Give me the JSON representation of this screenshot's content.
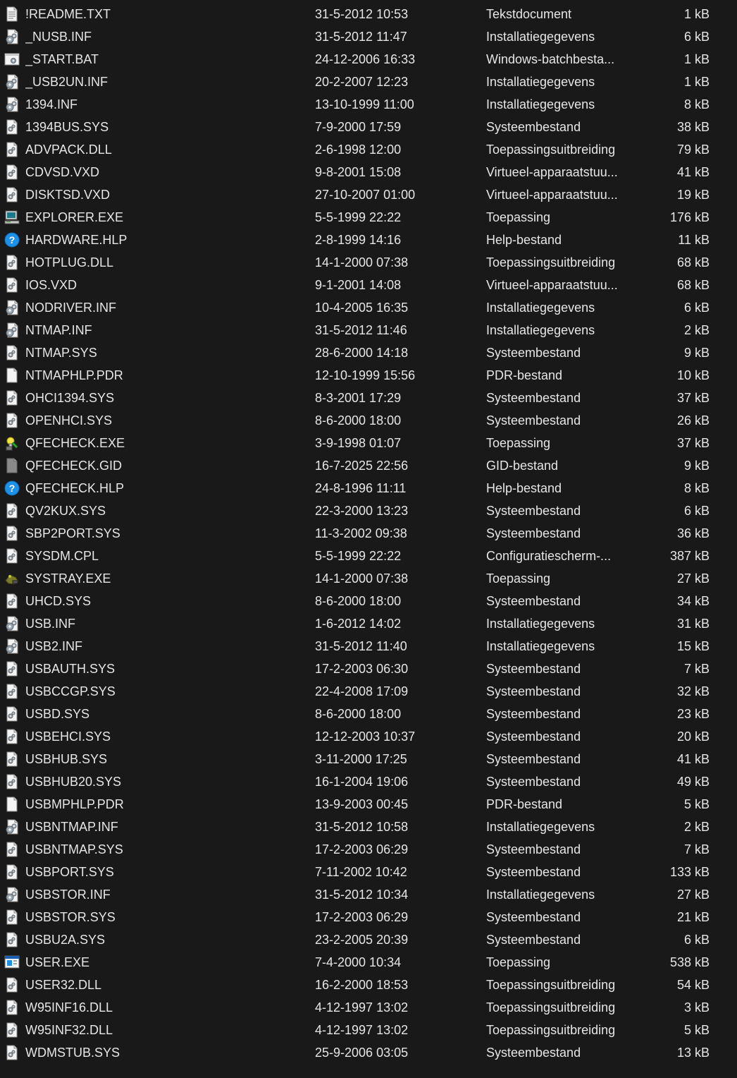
{
  "files": [
    {
      "name": "!README.TXT",
      "date": "31-5-2012 10:53",
      "type": "Tekstdocument",
      "size": "1 kB",
      "icon": "text-document-icon"
    },
    {
      "name": "_NUSB.INF",
      "date": "31-5-2012 11:47",
      "type": "Installatiegegevens",
      "size": "6 kB",
      "icon": "setup-info-icon"
    },
    {
      "name": "_START.BAT",
      "date": "24-12-2006 16:33",
      "type": "Windows-batchbesta...",
      "size": "1 kB",
      "icon": "batch-file-icon"
    },
    {
      "name": "_USB2UN.INF",
      "date": "20-2-2007 12:23",
      "type": "Installatiegegevens",
      "size": "1 kB",
      "icon": "setup-info-icon"
    },
    {
      "name": "1394.INF",
      "date": "13-10-1999 11:00",
      "type": "Installatiegegevens",
      "size": "8 kB",
      "icon": "setup-info-icon"
    },
    {
      "name": "1394BUS.SYS",
      "date": "7-9-2000 17:59",
      "type": "Systeembestand",
      "size": "38 kB",
      "icon": "system-file-icon"
    },
    {
      "name": "ADVPACK.DLL",
      "date": "2-6-1998 12:00",
      "type": "Toepassingsuitbreiding",
      "size": "79 kB",
      "icon": "system-file-icon"
    },
    {
      "name": "CDVSD.VXD",
      "date": "9-8-2001 15:08",
      "type": "Virtueel-apparaatstuu...",
      "size": "41 kB",
      "icon": "system-file-icon"
    },
    {
      "name": "DISKTSD.VXD",
      "date": "27-10-2007 01:00",
      "type": "Virtueel-apparaatstuu...",
      "size": "19 kB",
      "icon": "system-file-icon"
    },
    {
      "name": "EXPLORER.EXE",
      "date": "5-5-1999 22:22",
      "type": "Toepassing",
      "size": "176 kB",
      "icon": "computer-icon"
    },
    {
      "name": "HARDWARE.HLP",
      "date": "2-8-1999 14:16",
      "type": "Help-bestand",
      "size": "11 kB",
      "icon": "help-icon"
    },
    {
      "name": "HOTPLUG.DLL",
      "date": "14-1-2000 07:38",
      "type": "Toepassingsuitbreiding",
      "size": "68 kB",
      "icon": "system-file-icon"
    },
    {
      "name": "IOS.VXD",
      "date": "9-1-2001 14:08",
      "type": "Virtueel-apparaatstuu...",
      "size": "68 kB",
      "icon": "system-file-icon"
    },
    {
      "name": "NODRIVER.INF",
      "date": "10-4-2005 16:35",
      "type": "Installatiegegevens",
      "size": "6 kB",
      "icon": "setup-info-icon"
    },
    {
      "name": "NTMAP.INF",
      "date": "31-5-2012 11:46",
      "type": "Installatiegegevens",
      "size": "2 kB",
      "icon": "setup-info-icon"
    },
    {
      "name": "NTMAP.SYS",
      "date": "28-6-2000 14:18",
      "type": "Systeembestand",
      "size": "9 kB",
      "icon": "system-file-icon"
    },
    {
      "name": "NTMAPHLP.PDR",
      "date": "12-10-1999 15:56",
      "type": "PDR-bestand",
      "size": "10 kB",
      "icon": "blank-file-icon"
    },
    {
      "name": "OHCI1394.SYS",
      "date": "8-3-2001 17:29",
      "type": "Systeembestand",
      "size": "37 kB",
      "icon": "system-file-icon"
    },
    {
      "name": "OPENHCI.SYS",
      "date": "8-6-2000 18:00",
      "type": "Systeembestand",
      "size": "26 kB",
      "icon": "system-file-icon"
    },
    {
      "name": "QFECHECK.EXE",
      "date": "3-9-1998 01:07",
      "type": "Toepassing",
      "size": "37 kB",
      "icon": "wizard-icon"
    },
    {
      "name": "QFECHECK.GID",
      "date": "16-7-2025 22:56",
      "type": "GID-bestand",
      "size": "9 kB",
      "icon": "gray-file-icon"
    },
    {
      "name": "QFECHECK.HLP",
      "date": "24-8-1996 11:11",
      "type": "Help-bestand",
      "size": "8 kB",
      "icon": "help-icon"
    },
    {
      "name": "QV2KUX.SYS",
      "date": "22-3-2000 13:23",
      "type": "Systeembestand",
      "size": "6 kB",
      "icon": "system-file-icon"
    },
    {
      "name": "SBP2PORT.SYS",
      "date": "11-3-2002 09:38",
      "type": "Systeembestand",
      "size": "36 kB",
      "icon": "system-file-icon"
    },
    {
      "name": "SYSDM.CPL",
      "date": "5-5-1999 22:22",
      "type": "Configuratiescherm-...",
      "size": "387 kB",
      "icon": "system-file-icon"
    },
    {
      "name": "SYSTRAY.EXE",
      "date": "14-1-2000 07:38",
      "type": "Toepassing",
      "size": "27 kB",
      "icon": "systray-icon"
    },
    {
      "name": "UHCD.SYS",
      "date": "8-6-2000 18:00",
      "type": "Systeembestand",
      "size": "34 kB",
      "icon": "system-file-icon"
    },
    {
      "name": "USB.INF",
      "date": "1-6-2012 14:02",
      "type": "Installatiegegevens",
      "size": "31 kB",
      "icon": "setup-info-icon"
    },
    {
      "name": "USB2.INF",
      "date": "31-5-2012 11:40",
      "type": "Installatiegegevens",
      "size": "15 kB",
      "icon": "setup-info-icon"
    },
    {
      "name": "USBAUTH.SYS",
      "date": "17-2-2003 06:30",
      "type": "Systeembestand",
      "size": "7 kB",
      "icon": "system-file-icon"
    },
    {
      "name": "USBCCGP.SYS",
      "date": "22-4-2008 17:09",
      "type": "Systeembestand",
      "size": "32 kB",
      "icon": "system-file-icon"
    },
    {
      "name": "USBD.SYS",
      "date": "8-6-2000 18:00",
      "type": "Systeembestand",
      "size": "23 kB",
      "icon": "system-file-icon"
    },
    {
      "name": "USBEHCI.SYS",
      "date": "12-12-2003 10:37",
      "type": "Systeembestand",
      "size": "20 kB",
      "icon": "system-file-icon"
    },
    {
      "name": "USBHUB.SYS",
      "date": "3-11-2000 17:25",
      "type": "Systeembestand",
      "size": "41 kB",
      "icon": "system-file-icon"
    },
    {
      "name": "USBHUB20.SYS",
      "date": "16-1-2004 19:06",
      "type": "Systeembestand",
      "size": "49 kB",
      "icon": "system-file-icon"
    },
    {
      "name": "USBMPHLP.PDR",
      "date": "13-9-2003 00:45",
      "type": "PDR-bestand",
      "size": "5 kB",
      "icon": "blank-file-icon"
    },
    {
      "name": "USBNTMAP.INF",
      "date": "31-5-2012 10:58",
      "type": "Installatiegegevens",
      "size": "2 kB",
      "icon": "setup-info-icon"
    },
    {
      "name": "USBNTMAP.SYS",
      "date": "17-2-2003 06:29",
      "type": "Systeembestand",
      "size": "7 kB",
      "icon": "system-file-icon"
    },
    {
      "name": "USBPORT.SYS",
      "date": "7-11-2002 10:42",
      "type": "Systeembestand",
      "size": "133 kB",
      "icon": "system-file-icon"
    },
    {
      "name": "USBSTOR.INF",
      "date": "31-5-2012 10:34",
      "type": "Installatiegegevens",
      "size": "27 kB",
      "icon": "setup-info-icon"
    },
    {
      "name": "USBSTOR.SYS",
      "date": "17-2-2003 06:29",
      "type": "Systeembestand",
      "size": "21 kB",
      "icon": "system-file-icon"
    },
    {
      "name": "USBU2A.SYS",
      "date": "23-2-2005 20:39",
      "type": "Systeembestand",
      "size": "6 kB",
      "icon": "system-file-icon"
    },
    {
      "name": "USER.EXE",
      "date": "7-4-2000 10:34",
      "type": "Toepassing",
      "size": "538 kB",
      "icon": "app-window-icon"
    },
    {
      "name": "USER32.DLL",
      "date": "16-2-2000 18:53",
      "type": "Toepassingsuitbreiding",
      "size": "54 kB",
      "icon": "system-file-icon"
    },
    {
      "name": "W95INF16.DLL",
      "date": "4-12-1997 13:02",
      "type": "Toepassingsuitbreiding",
      "size": "3 kB",
      "icon": "system-file-icon"
    },
    {
      "name": "W95INF32.DLL",
      "date": "4-12-1997 13:02",
      "type": "Toepassingsuitbreiding",
      "size": "5 kB",
      "icon": "system-file-icon"
    },
    {
      "name": "WDMSTUB.SYS",
      "date": "25-9-2006 03:05",
      "type": "Systeembestand",
      "size": "13 kB",
      "icon": "system-file-icon"
    }
  ],
  "colors": {
    "background": "#191919",
    "text": "#e6e6e6"
  }
}
